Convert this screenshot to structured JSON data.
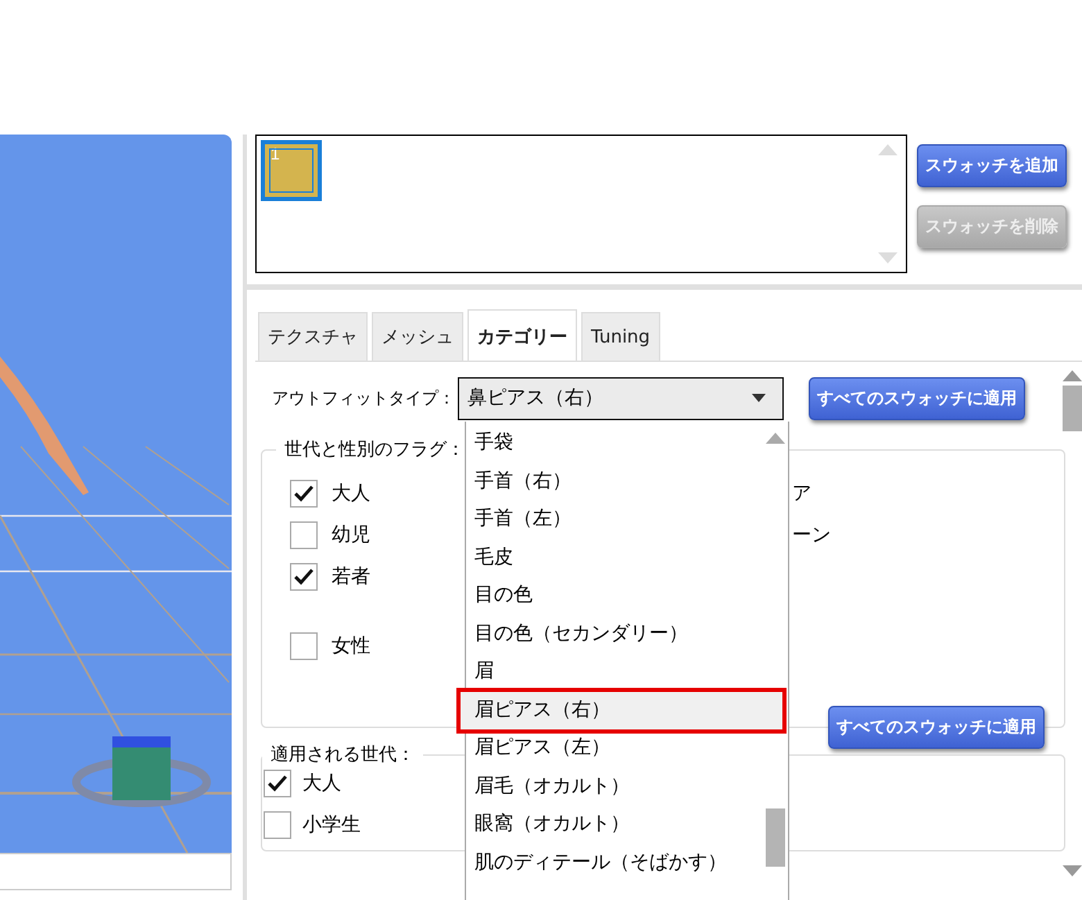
{
  "swatches": [
    {
      "label": "1",
      "color": "#d4b44e",
      "selected": true
    }
  ],
  "swatch_buttons": [
    {
      "label": "スウォッチを追加",
      "disabled": false
    },
    {
      "label": "スウォッチを削除",
      "disabled": true
    }
  ],
  "tabs": [
    {
      "label": "テクスチャ",
      "selected": false
    },
    {
      "label": "メッシュ",
      "selected": false
    },
    {
      "label": "カテゴリー",
      "selected": true
    },
    {
      "label": "Tuning",
      "selected": false
    }
  ],
  "outfit_type": {
    "label": "アウトフィットタイプ：",
    "value": "鼻ピアス（右）",
    "apply_button": "すべてのスウォッチに適用"
  },
  "dropdown_options": [
    {
      "label": "手袋",
      "selected": false
    },
    {
      "label": "手首（右）",
      "selected": false
    },
    {
      "label": "手首（左）",
      "selected": false
    },
    {
      "label": "毛皮",
      "selected": false
    },
    {
      "label": "目の色",
      "selected": false
    },
    {
      "label": "目の色（セカンダリー）",
      "selected": false
    },
    {
      "label": "眉",
      "selected": false
    },
    {
      "label": "眉ピアス（右）",
      "selected": true
    },
    {
      "label": "眉ピアス（左）",
      "selected": false
    },
    {
      "label": "眉毛（オカルト）",
      "selected": false
    },
    {
      "label": "眼窩（オカルト）",
      "selected": false
    },
    {
      "label": "肌のディテール（そばかす）",
      "selected": false
    }
  ],
  "age_gender_flags": {
    "title": "世代と性別のフラグ：",
    "checkboxes": [
      {
        "label": "大人",
        "checked": true
      },
      {
        "label": "幼児",
        "checked": false
      },
      {
        "label": "若者",
        "checked": true
      },
      {
        "label": "女性",
        "checked": false
      }
    ],
    "partial_labels": [
      "ア",
      "ーン"
    ],
    "apply_button": "すべてのスウォッチに適用"
  },
  "applied_ages": {
    "title": "適用される世代：",
    "checkboxes": [
      {
        "label": "大人",
        "checked": true
      },
      {
        "label": "小学生",
        "checked": false
      }
    ]
  }
}
